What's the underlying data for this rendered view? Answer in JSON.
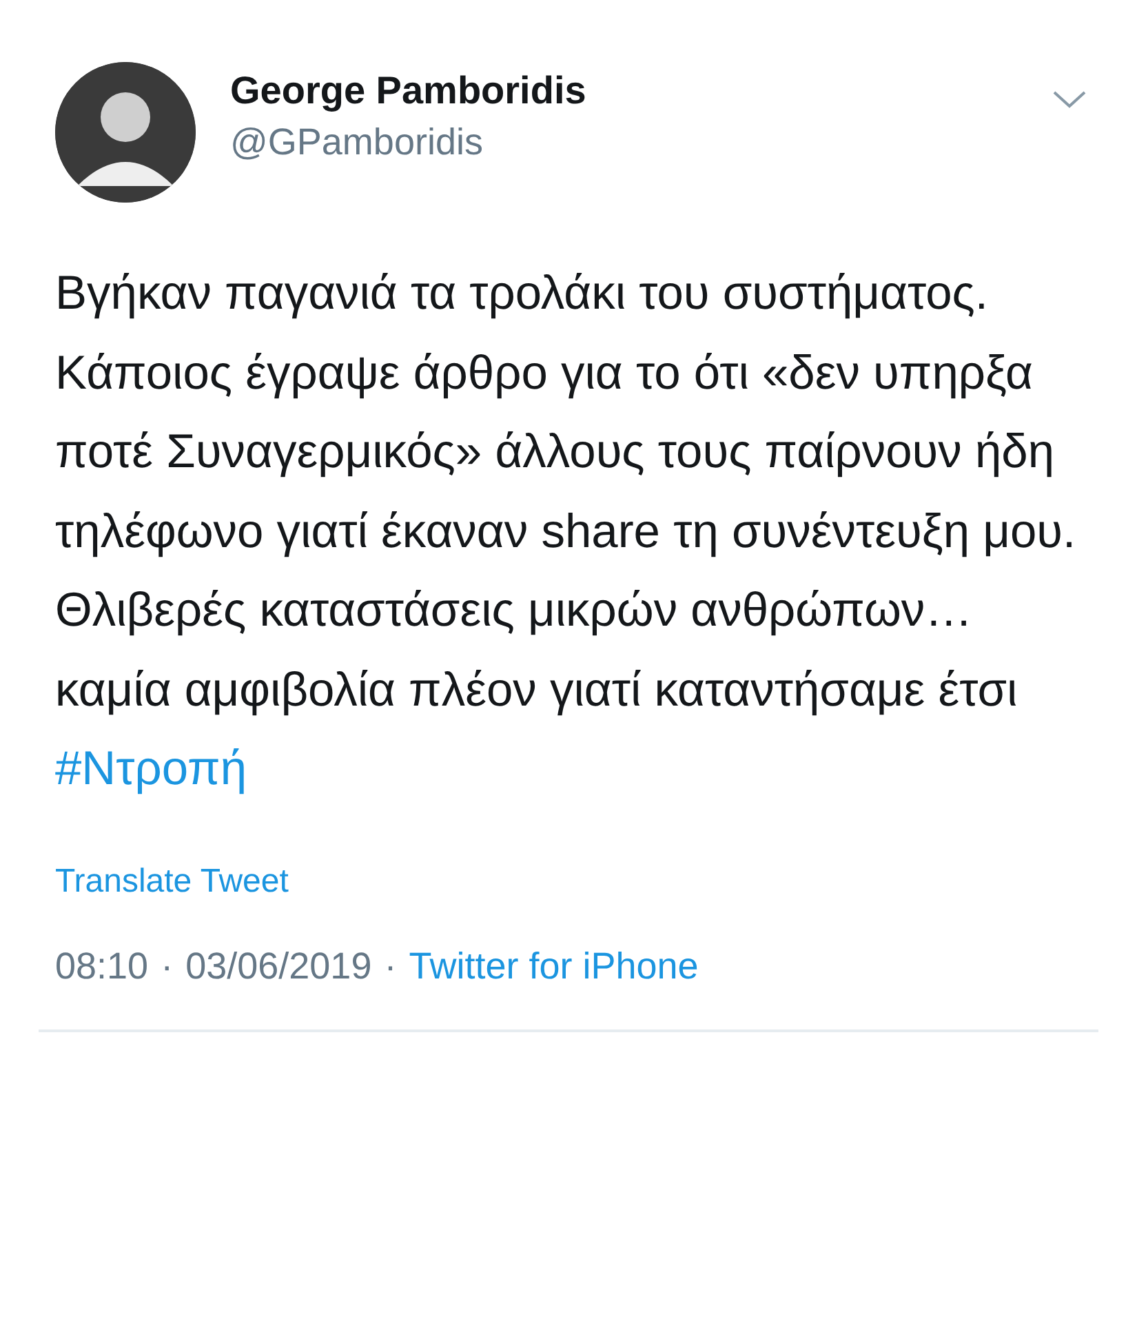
{
  "author": {
    "name": "George Pamboridis",
    "handle": "@GPamboridis"
  },
  "tweet": {
    "text": "Βγήκαν παγανιά τα τρολάκι του συστήματος. Κάποιος έγραψε άρθρο για το ότι «δεν υπηρξα ποτέ Συναγερμικός» άλλους τους παίρνουν ήδη τηλέφωνο γιατί έκαναν share τη συνέντευξη μου. Θλιβερές καταστάσεις μικρών ανθρώπων… καμία αμφιβολία πλέον γιατί καταντήσαμε έτσι",
    "hashtag": "#Ντροπή"
  },
  "translate": "Translate Tweet",
  "meta": {
    "time": "08:10",
    "separator_1": "·",
    "date": "03/06/2019",
    "separator_2": "·",
    "source": "Twitter for iPhone"
  }
}
